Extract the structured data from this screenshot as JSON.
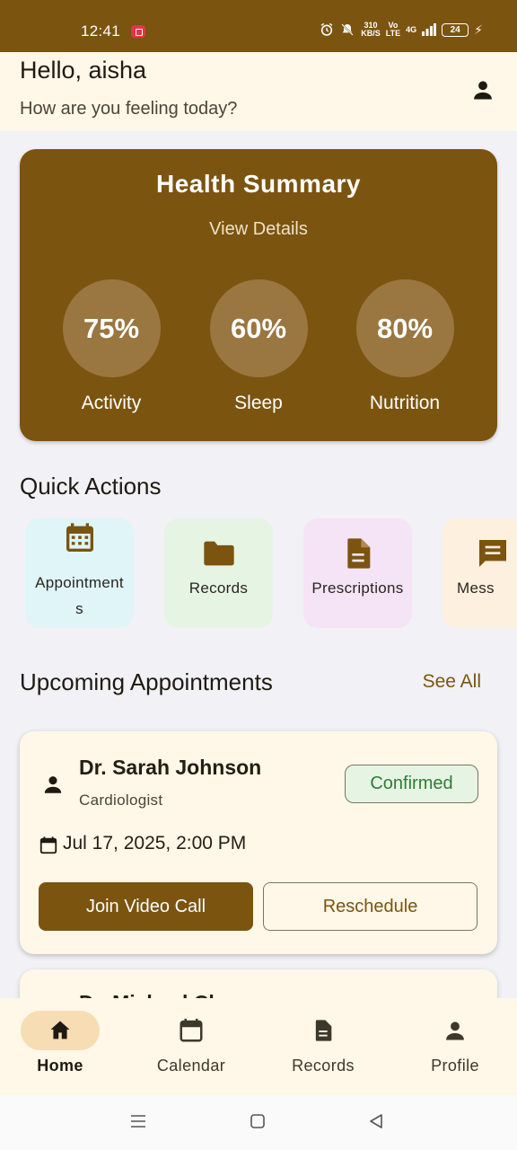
{
  "status_bar": {
    "time": "12:41",
    "net_speed_value": "310",
    "net_speed_unit": "KB/S",
    "volte_top": "Vo",
    "volte_bottom": "LTE",
    "network": "4G",
    "battery": "24"
  },
  "header": {
    "greeting": "Hello, aisha",
    "subtitle": "How are you feeling today?",
    "account_icon": "person-icon"
  },
  "health_summary": {
    "title": "Health Summary",
    "link": "View Details",
    "metrics": [
      {
        "value": "75%",
        "label": "Activity"
      },
      {
        "value": "60%",
        "label": "Sleep"
      },
      {
        "value": "80%",
        "label": "Nutrition"
      }
    ]
  },
  "quick_actions": {
    "title": "Quick Actions",
    "items": [
      {
        "label_line1": "Appointment",
        "label_line2": "s",
        "icon": "calendar-grid-icon",
        "color": "#dff5f8"
      },
      {
        "label": "Records",
        "icon": "folder-icon",
        "color": "#e6f4e4"
      },
      {
        "label": "Prescriptions",
        "icon": "document-icon",
        "color": "#f5e4f5"
      },
      {
        "label": "Mess",
        "icon": "message-icon",
        "color": "#fdf0de"
      }
    ]
  },
  "upcoming": {
    "title": "Upcoming Appointments",
    "see_all": "See All",
    "appointment": {
      "doctor": "Dr. Sarah Johnson",
      "specialty": "Cardiologist",
      "status": "Confirmed",
      "datetime": "Jul 17, 2025, 2:00 PM",
      "primary_action": "Join Video Call",
      "secondary_action": "Reschedule"
    },
    "next_doctor_partial": "Dr. Michael Ch"
  },
  "bottom_nav": [
    {
      "label": "Home",
      "icon": "home-icon",
      "active": true
    },
    {
      "label": "Calendar",
      "icon": "calendar-icon",
      "active": false
    },
    {
      "label": "Records",
      "icon": "document-icon",
      "active": false
    },
    {
      "label": "Profile",
      "icon": "person-icon",
      "active": false
    }
  ],
  "colors": {
    "brand": "#7b5410",
    "header_bg": "#fff7e7",
    "page_bg": "#f1f1f6",
    "confirmed_text": "#2e7d32",
    "confirmed_bg": "#e6f4e3",
    "nav_active_pill": "#f7ddb4"
  }
}
